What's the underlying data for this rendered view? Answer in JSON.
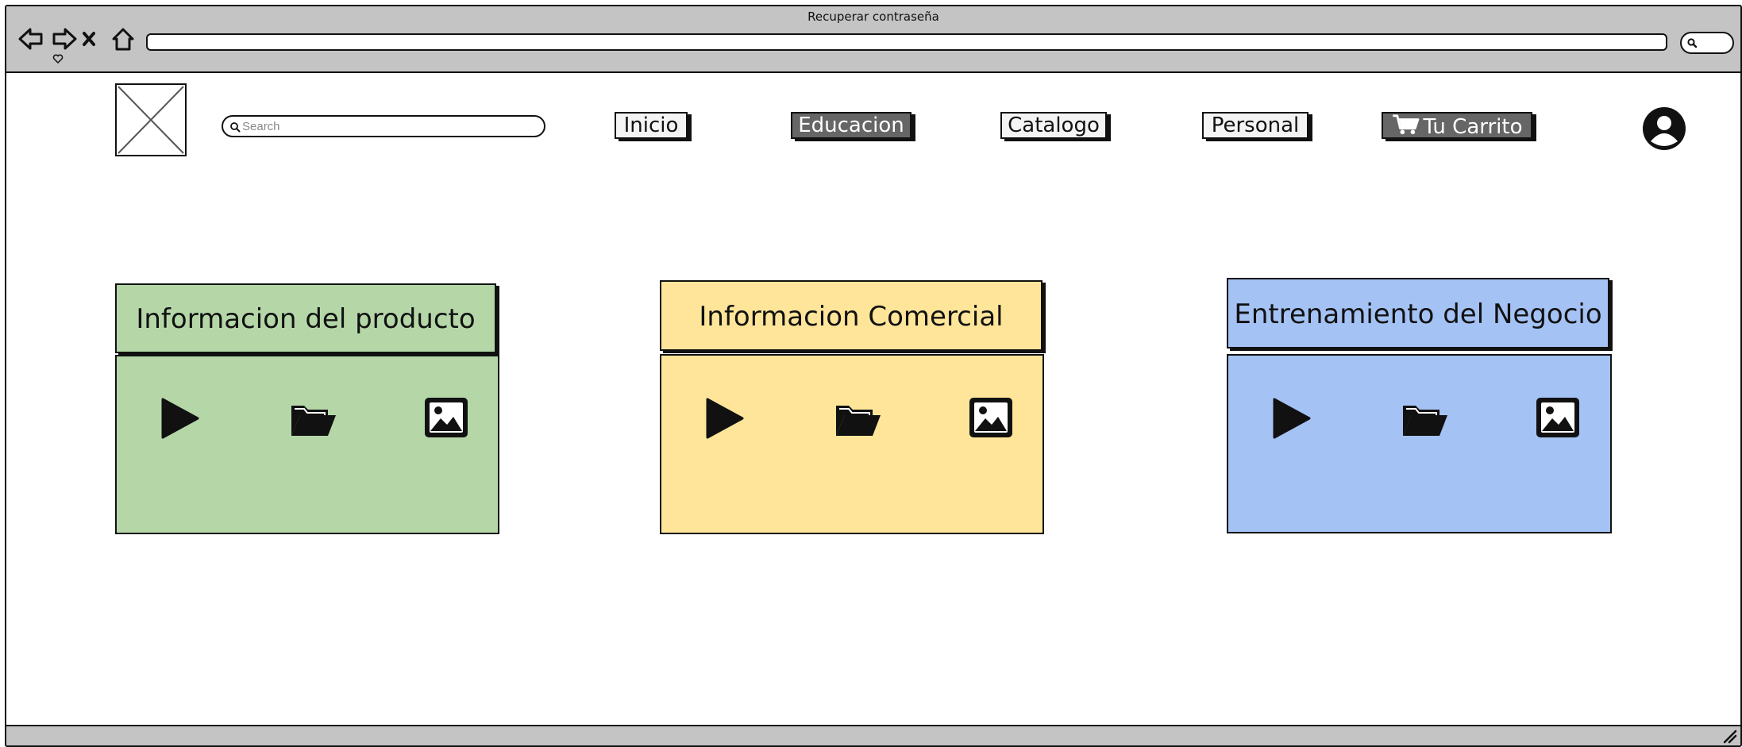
{
  "window": {
    "title": "Recuperar contraseña"
  },
  "browser": {
    "url": ""
  },
  "search": {
    "placeholder": "Search"
  },
  "nav": {
    "items": [
      {
        "label": "Inicio",
        "active": false
      },
      {
        "label": "Educacion",
        "active": true
      },
      {
        "label": "Catalogo",
        "active": false
      },
      {
        "label": "Personal",
        "active": false
      },
      {
        "label": "Tu Carrito",
        "active": true,
        "icon": "cart-icon"
      }
    ]
  },
  "cards": [
    {
      "title": "Informacion del producto",
      "color": "#b5d7a8",
      "icons": [
        "play-icon",
        "folder-icon",
        "image-icon"
      ]
    },
    {
      "title": "Informacion Comercial",
      "color": "#ffe599",
      "icons": [
        "play-icon",
        "folder-icon",
        "image-icon"
      ]
    },
    {
      "title": "Entrenamiento del Negocio",
      "color": "#a4c2f4",
      "icons": [
        "play-icon",
        "folder-icon",
        "image-icon"
      ]
    }
  ],
  "colors": {
    "chrome": "#c4c4c4",
    "active_tab": "#666666"
  }
}
